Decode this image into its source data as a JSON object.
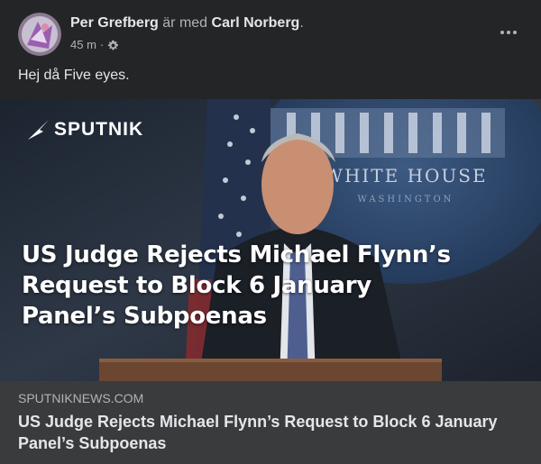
{
  "post": {
    "author": "Per Grefberg",
    "with_text": "är med",
    "tagged": "Carl Norberg",
    "period": ".",
    "time": "45 m",
    "separator": "·",
    "audience_icon": "gear-icon",
    "more_icon": "more-options-icon",
    "caption": "Hej då Five eyes."
  },
  "link": {
    "logo_text": "SPUTNIK",
    "headline_overlay_lines": [
      "US Judge Rejects Michael Flynn’s",
      "Request to Block 6 January",
      "Panel’s Subpoenas"
    ],
    "domain": "SPUTNIKNEWS.COM",
    "title": "US Judge Rejects Michael Flynn’s Request to Block 6 January Panel’s Subpoenas",
    "background_sign_text": "WHITE HOUSE",
    "background_sign_subtext": "WASHINGTON"
  },
  "colors": {
    "background": "#242526",
    "footer": "#3a3b3c",
    "primary_text": "#e4e6eb",
    "secondary_text": "#b0b3b8"
  }
}
